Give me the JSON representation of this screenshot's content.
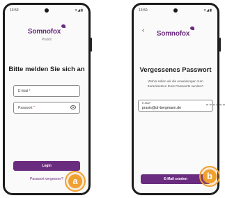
{
  "left_screen": {
    "status_time": "13:50",
    "status_icons": "▾◢▮",
    "brand": "Somnofox",
    "brand_sub": "Praxis",
    "heading": "Bitte melden Sie sich an",
    "email_label": "E-Mail",
    "password_label": "Passwort",
    "required_mark": "*",
    "login_button": "Login",
    "forgot_link": "Passwort vergessen?"
  },
  "right_screen": {
    "status_time": "13:50",
    "status_icons": "▾◢▮",
    "back_glyph": "‹",
    "brand": "Somnofox",
    "heading": "Vergessenes Passwort",
    "description": "Wohin sollen wir die Anweisungen zum Zurücksetzen Ihres Passworts senden?",
    "email_label": "E-Mail",
    "required_mark": "*",
    "email_value": "praxis@dr-bergmann.de",
    "send_button": "E-Mail senden"
  },
  "annotations": {
    "badge_a": "a",
    "badge_b": "b"
  },
  "colors": {
    "brand": "#6a2c7e",
    "badge": "#f0a030"
  },
  "icons": [
    "eye-icon",
    "back-chevron-icon",
    "somnofox-logo-mark"
  ]
}
